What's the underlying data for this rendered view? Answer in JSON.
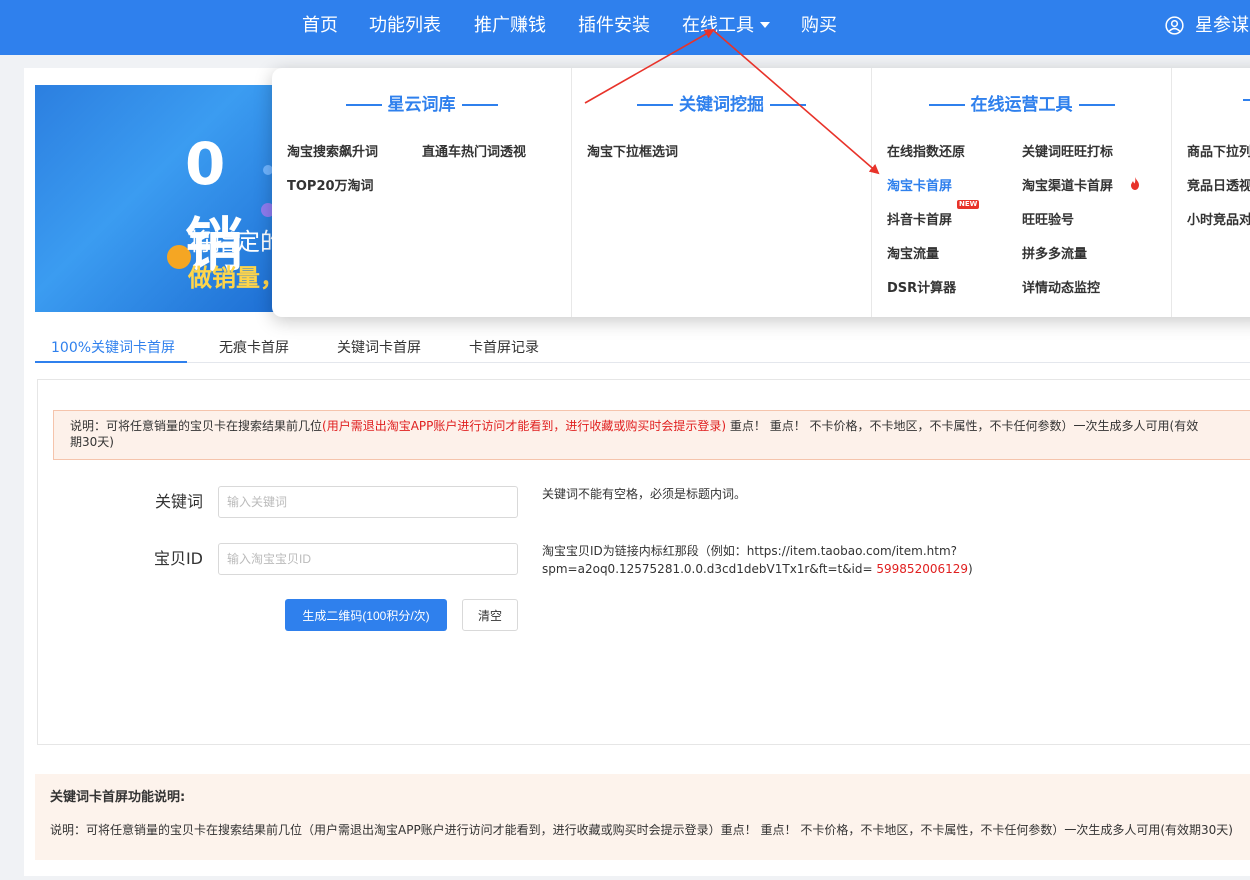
{
  "nav": {
    "items": [
      "首页",
      "功能列表",
      "推广赚钱",
      "插件安装",
      "在线工具",
      "购买"
    ],
    "user": "星参谋"
  },
  "banner": {
    "big": "0销",
    "line1": "将指定的",
    "line2": "做销量，"
  },
  "dropdown": {
    "columns": [
      {
        "title": "星云词库",
        "items": [
          "淘宝搜索飙升词",
          "直通车热门词透视",
          "TOP20万淘词"
        ]
      },
      {
        "title": "关键词挖掘",
        "items": [
          "淘宝下拉框选词"
        ]
      },
      {
        "title": "在线运营工具",
        "items": [
          "在线指数还原",
          "关键词旺旺打标",
          "淘宝卡首屏",
          "淘宝渠道卡首屏",
          "抖音卡首屏",
          "旺旺验号",
          "淘宝流量",
          "拼多多流量",
          "DSR计算器",
          "详情动态监控"
        ]
      },
      {
        "title": "",
        "items": [
          "商品下拉列",
          "竞品日透视",
          "小时竞品对"
        ]
      }
    ],
    "new_badge": "NEW"
  },
  "tabs": [
    "100%关键词卡首屏",
    "无痕卡首屏",
    "关键词卡首屏",
    "卡首屏记录"
  ],
  "notice": {
    "prefix": "说明：可将任意销量的宝贝卡在搜索结果前几位",
    "red": "(用户需退出淘宝APP账户进行访问才能看到，进行收藏或购买时会提示登录)",
    "suffix": "重点！ 重点！ 不卡价格，不卡地区，不卡属性，不卡任何参数）一次生成多人可用(有效",
    "line2": "期30天)"
  },
  "form": {
    "keyword_label": "关键词",
    "keyword_placeholder": "输入关键词",
    "keyword_hint": "关键词不能有空格，必须是标题内词。",
    "id_label": "宝贝ID",
    "id_placeholder": "输入淘宝宝贝ID",
    "id_hint_line1": "淘宝宝贝ID为链接内标红那段（例如：https://item.taobao.com/item.htm?",
    "id_hint_line2_prefix": "spm=a2oq0.12575281.0.0.d3cd1debV1Tx1r&ft=t&id=",
    "id_hint_number": "599852006129",
    "id_hint_line2_suffix": ")",
    "generate_button": "生成二维码(100积分/次)",
    "clear_button": "清空"
  },
  "description": {
    "title": "关键词卡首屏功能说明:",
    "text": "说明：可将任意销量的宝贝卡在搜索结果前几位（用户需退出淘宝APP账户进行访问才能看到，进行收藏或购买时会提示登录）重点！ 重点！ 不卡价格，不卡地区，不卡属性，不卡任何参数）一次生成多人可用(有效期30天)"
  },
  "colors": {
    "primary": "#2f80ed",
    "annotation_arrow": "#e8332a"
  }
}
